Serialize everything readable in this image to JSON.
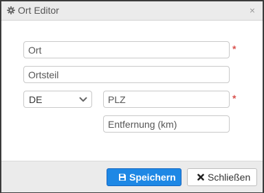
{
  "dialog": {
    "title": "Ort Editor",
    "title_icon": "gear-icon",
    "close_glyph": "×"
  },
  "form": {
    "ort": {
      "value": "",
      "placeholder": "Ort",
      "required": true
    },
    "ortsteil": {
      "value": "",
      "placeholder": "Ortsteil",
      "required": false
    },
    "country": {
      "selected": "DE",
      "icon": "chevron-down-icon"
    },
    "plz": {
      "value": "",
      "placeholder": "PLZ",
      "required": true
    },
    "entfernung": {
      "value": "",
      "placeholder": "Entfernung (km)",
      "required": false
    },
    "required_marker": "*"
  },
  "footer": {
    "save": {
      "label": "Speichern",
      "icon": "floppy-disk-icon"
    },
    "close": {
      "label": "Schließen",
      "icon": "x-icon"
    }
  },
  "colors": {
    "primary": "#1e88e5",
    "required": "#d9534f",
    "titlebar": "#ebebeb"
  }
}
